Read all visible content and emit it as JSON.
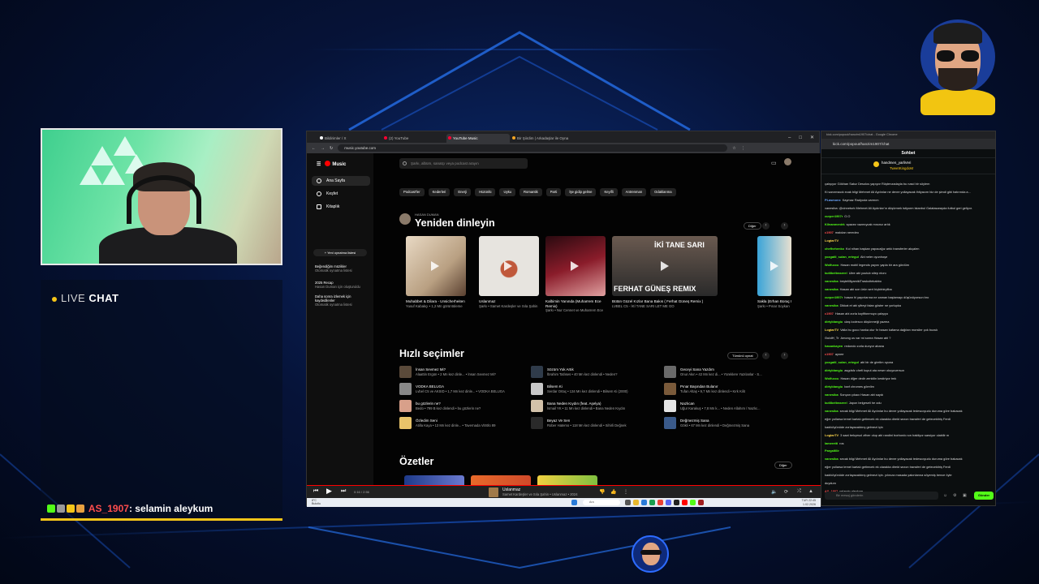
{
  "livechat": {
    "title_live": "LIVE",
    "title_chat": "CHAT",
    "user": "AS_1907",
    "message": ": selamin aleykum"
  },
  "browser": {
    "tabs": [
      "Bildirimler / X",
      "(2) YouTube",
      "YouTube Music",
      "Bir Şiirdim | Arkadaşlar ile Oyna"
    ],
    "url": "music.youtube.com"
  },
  "yt": {
    "logo": "Music",
    "search_placeholder": "Şarkı, albüm, sanatçı veya podcast arayın",
    "nav": [
      "Ana Sayfa",
      "Keşfet",
      "Kitaplık"
    ],
    "new_playlist": "+ Yeni oynatma listesi",
    "playlists": [
      {
        "t": "Beğendiğim müzikler",
        "s": "Otomatik oynatma listesi"
      },
      {
        "t": "2025 Recap",
        "s": "Hasan Duman için oluşturuldu"
      },
      {
        "t": "Daha sonra izlemek için kaydedilenler",
        "s": "Otomatik oynatma listesi"
      }
    ],
    "chips": [
      "Podcast'ler",
      "Kederleri",
      "Enerji",
      "Hüzünlü",
      "Uyku",
      "Romantik",
      "Parti",
      "İşe gidip gelme",
      "Keyifli",
      "Antrenman",
      "Odaklanma"
    ],
    "listen_again": {
      "user": "HASAN DUMAN",
      "title": "Yeniden dinleyin",
      "more": "Diğer"
    },
    "cards": [
      {
        "t": "Muhabbet & Dilara - Unsicherheiten",
        "s": "Yusuf Kabakçı • 1,2 Mn görüntüleme",
        "color1": "#b9a082",
        "color2": "#e8d9c4"
      },
      {
        "t": "Uslanmaz",
        "s": "Şarkı • Samet Kardeşler ve Sıla Şahin",
        "color1": "#e7e4df",
        "color2": "#c9c4bc"
      },
      {
        "t": "Kalbimin Yanında (Muharrem Ece Remix)",
        "s": "Şarkı • Nur Cennet ve Muharrem Ece",
        "color1": "#5b0f1a",
        "color2": "#c73a4a"
      },
      {
        "t": "Bütün Güzel Kızlar Bana Bakıs ( Ferhat Güneş Remix )",
        "s": "LVBEL C5 - İKİ TANE SARI LET ME GO",
        "color1": "#2b2b2b",
        "color2": "#8a6a55"
      },
      {
        "t": "Sakla (Erhan Boraç Remix)",
        "s": "Şarkı • Pınar Soykan",
        "color1": "#3aa4d8",
        "color2": "#e8e0d0"
      }
    ],
    "card_overlay": "FERHAT GÜNEŞ REMIX",
    "card_overlay2": "İKİ TANE SARI",
    "quick": {
      "title": "Hızlı seçimler",
      "play_all": "Tümünü oynat",
      "items": [
        {
          "n": "İnsan Sevmez Mi?",
          "d": "Alaattin Ergün • 2 Mn kez dinle... • İnsan Sevmez Mi?",
          "c": "#5a4a3a"
        },
        {
          "n": "Sözüm Yok Artık",
          "d": "İbrahim Tatlıses • 40 Mn kez dinlendi • Neden?",
          "c": "#2f3b4a"
        },
        {
          "n": "Geceyi Sana Yazdım",
          "d": "Onur Akın • 42 Mn kez di... • Yüreklere Yazılanlar - S...",
          "c": "#6a6a6a"
        },
        {
          "n": "VODKA BELUGA",
          "d": "Lvbel C5 ve AKSID • 1,7 Mn kez dinle... • VODKA BELUGA",
          "c": "#888"
        },
        {
          "n": "Bilsem Ki",
          "d": "Serdar Ortaç • 134 Mn kez dinlendi • Bilsem Ki (2000)",
          "c": "#c8c8c8"
        },
        {
          "n": "Pınar Başından Bulanır",
          "d": "Tufan Altaş • 9,7 Mn kez dinlendi • Kırk Kilit",
          "c": "#7a5a3a"
        },
        {
          "n": "bu gözlerin ne?",
          "d": "Bedo • 799 B kez dinlendi • bu gözlerin ne?",
          "c": "#d8a08a"
        },
        {
          "n": "Bana Neden Kıydın (feat. Aşelya)",
          "d": "İsmail YK • 11 Mn kez dinlendi • Bana Neden Kıydın",
          "c": "#d3c2aa"
        },
        {
          "n": "Nazlıcan",
          "d": "Uğur Karakuş • 7,8 Mn k... • Neden Allahım / Nazlıc...",
          "c": "#e4e4e4"
        },
        {
          "n": "Özledim Seni",
          "d": "Atilla Kaya • 13 Mn kez dinle... • Tavernada Vitrölü 89",
          "c": "#e8c36a"
        },
        {
          "n": "Beyaz Ve Sen",
          "d": "Rober Hatemo • 118 Mn kez dinlendi • Sihirli Değnek",
          "c": "#2a2a2a"
        },
        {
          "n": "Değmezmiş Sana",
          "d": "Gökli • 67 Mn kez dinlendi • Değmezmiş Sana",
          "c": "#3a5a8a"
        }
      ]
    },
    "summary": {
      "title": "Özetler",
      "more": "Diğer"
    }
  },
  "player": {
    "time": "0:16 / 2:56",
    "title": "Uslanmaz",
    "sub": "Samet Kardeşler ve Sıla Şahin • Uslanmaz • 2024"
  },
  "taskbar": {
    "weather1": "8°C",
    "weather2": "Bulutlu",
    "search": "Ara",
    "time": "22:45",
    "date": "1.02.2026",
    "lang": "TUR"
  },
  "kick": {
    "titlebar": "kick.com/popout/hanzim1907/chat - Google Chrome",
    "url": "kick.com/popout/hanzim1907/chat",
    "header": "Sohbet",
    "pinned_user": "handmen_yarliVeri",
    "pinned_text": "TweetKingdoM",
    "lines": [
      {
        "u": "",
        "t": "çalışıyor Gökhan Sakız Desolos yapıyor Rüştenzadayla bu nasıl bir söylem",
        "c": "#aaa"
      },
      {
        "u": "",
        "t": "Ki sanırmacık ecak bilgi Mehmet Ali Aydınlar ne devre yollayacak ihtiyacım biz de şimdi gibi hatırında a...",
        "c": "#666"
      },
      {
        "u": "PLasmonx",
        "t": "Kaymaz Radyoda varmım",
        "c": "#6ea8ff"
      },
      {
        "u": "",
        "t": "vanesiba: @cinneturk Mehmet Ali Aydınlar'ın düşürmek istiyorm lstanbul Galatasarayda futbol geri geliyor.",
        "c": "#666"
      },
      {
        "u": "curper1907r",
        "t": "O.O",
        "c": "#53fc18"
      },
      {
        "u": "Kilnanmenirk",
        "t": "spacez vazmıycak mısınız artık",
        "c": "#53fc18"
      },
      {
        "u": "c1907",
        "t": "malıdan neredeo",
        "c": "#ff4d4d"
      },
      {
        "u": "LogtarTV",
        "t": "",
        "c": "#ffd84d"
      },
      {
        "u": "chefhehenko",
        "t": "Kol nihan başkan yapacağız artık transferler akçalen",
        "c": "#53fc18"
      },
      {
        "u": "yozgatli_sulan_ertegul",
        "t": "Abi neler oyunhoşe",
        "c": "#53fc18"
      },
      {
        "u": "Wolfuccu",
        "t": "Hasan mobil legends yayını yapla bir ara gördüm",
        "c": "#53fc18"
      },
      {
        "u": "kutlibeltrasreel",
        "t": "Ulee abi youtub sitep ntonı",
        "c": "#53fc18"
      },
      {
        "u": "vanesiba",
        "t": "beştelilliyamikiTraskoltekabbo",
        "c": "#53fc18"
      },
      {
        "u": "vanesiba",
        "t": "Hasan abi son ürün sert hiçbirbiryliba",
        "c": "#53fc18"
      },
      {
        "u": "curper1907r",
        "t": "hasan hi yayınlarına ne zaman başlamayı düşünüyorsun bro",
        "c": "#53fc18"
      },
      {
        "u": "vanesiba",
        "t": "Dikkat et abi şifreyi falan göster ne yorlupka",
        "c": "#53fc18"
      },
      {
        "u": "c1907",
        "t": "Hasan abi zorla koyfifonmuyo çalışıyo",
        "c": "#ff4d4d"
      },
      {
        "u": "dirtyblangiu",
        "t": "ulaş loolesco düşünmeği yazma",
        "c": "#53fc18"
      },
      {
        "u": "LogtarTV",
        "t": "Valla bu goco hanka olur fır hasan kafama dağıtan morsiler çok bozuk",
        "c": "#ffd84d"
      },
      {
        "u": "GoldH_Tr",
        "t": "Among us var mi sonra Hasan abi ?",
        "c": "#aaa"
      },
      {
        "u": "hasankayen",
        "t": "redondo zorla dunyor abana",
        "c": "#53fc18"
      },
      {
        "u": "c1907",
        "t": "aynee",
        "c": "#ff4d4d"
      },
      {
        "u": "yozgatli_sulan_ertegul",
        "t": "abi bir de girelim oyuna",
        "c": "#53fc18"
      },
      {
        "u": "dirtyblangiu",
        "t": "asgdsfz chefi kuput ata neser okuyuversun",
        "c": "#53fc18"
      },
      {
        "u": "Wolfuccu",
        "t": "Hasan diğer dedir zenkilin kestiriyor tmk",
        "c": "#53fc18"
      },
      {
        "u": "dirtyblangiu",
        "t": "barf chromes görelim",
        "c": "#53fc18"
      },
      {
        "u": "vanesiba",
        "t": "Sonçan çıkacı Hasan abi saydı",
        "c": "#53fc18"
      },
      {
        "u": "kutlibeltrasreel",
        "t": "Japon belgeseli he odu",
        "c": "#53fc18"
      },
      {
        "u": "vanesiba",
        "t": "secak bilgi Mehmet Ali Aydınlar bu devre yollayacak tedescoyudu duruma göre bakacak",
        "c": "#53fc18"
      },
      {
        "u": "",
        "t": "eğer yollarsa temel kartalı getirecek ek olarakta direkt sezon transferi de getecektiriş Ferdi",
        "c": "#aaa"
      },
      {
        "u": "",
        "t": "kadıköyünüde zorlayacaktırış gelmezi için",
        "c": "#aaa"
      },
      {
        "u": "LogtarTV",
        "t": "3 saat bekçesol zifver olup abi randini borbordo sırı baktiyor sarsiyor olabilir m",
        "c": "#ffd84d"
      },
      {
        "u": "lameretti",
        "t": "ros",
        "c": "#53fc18"
      },
      {
        "u": "Pargaltllir",
        "t": "",
        "c": "#53fc18"
      },
      {
        "u": "vanesiba",
        "t": "secak bilgi Mehmet Ali Aydınlar bu devre yollayacak tedescoyudu duruma göre bakacak",
        "c": "#53fc18"
      },
      {
        "u": "",
        "t": "eğer yollarsa temel kartalı getirecek ek olarakta direkt sezon transferi de getecektiriş Ferdi",
        "c": "#aaa"
      },
      {
        "u": "",
        "t": "kadıköyünüde zorlayacaktırış gelmezi için. yılınıza masada yakınlarına söyemiş bence öyle",
        "c": "#aaa"
      },
      {
        "u": "",
        "t": "duydum",
        "c": "#aaa"
      },
      {
        "u": "AS_1907",
        "t": "selamin aleykum",
        "c": "#ff4d4d"
      }
    ],
    "input_placeholder": "Bir mesaj gönderin",
    "send": "Gönder"
  }
}
